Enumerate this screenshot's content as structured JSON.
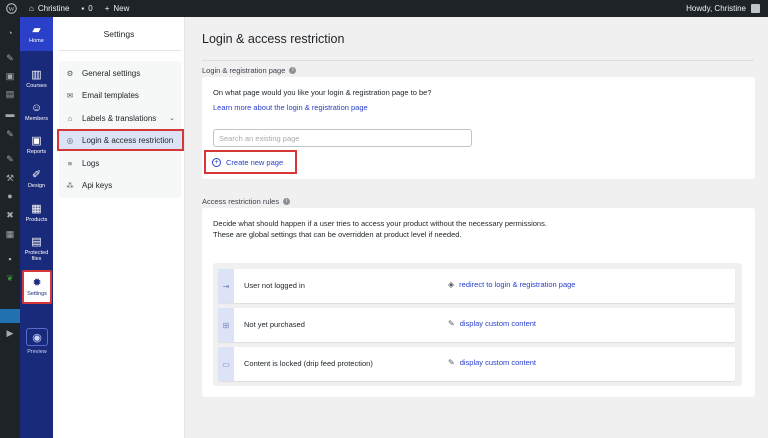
{
  "adminbar": {
    "site_name": "Christine",
    "comments_count": "0",
    "new_label": "New",
    "greeting": "Howdy, Christine"
  },
  "plugin_nav": {
    "home": "Home",
    "courses": "Courses",
    "members": "Members",
    "reports": "Reports",
    "design": "Design",
    "products": "Products",
    "protected_files": "Protected files",
    "settings": "Settings",
    "preview": "Preview"
  },
  "settings_nav": {
    "title": "Settings",
    "items": [
      {
        "label": "General settings",
        "icon": "gear-icon"
      },
      {
        "label": "Email templates",
        "icon": "envelope-icon"
      },
      {
        "label": "Labels & translations",
        "icon": "tag-icon"
      },
      {
        "label": "Login & access restriction",
        "icon": "eye-icon"
      },
      {
        "label": "Logs",
        "icon": "list-icon"
      },
      {
        "label": "Api keys",
        "icon": "api-icon"
      }
    ]
  },
  "main": {
    "title": "Login & access restriction",
    "login_page": {
      "label": "Login & registration page",
      "question": "On what page would you like your login & registration page to be?",
      "learn_more": "Learn more about the login & registration page",
      "search_placeholder": "Search an existing page",
      "create_button": "Create new page"
    },
    "rules": {
      "label": "Access restriction rules",
      "description_line1": "Decide what should happen if a user tries to access your product without the necessary permissions.",
      "description_line2": "These are global settings that can be overridden at product level if needed.",
      "rows": [
        {
          "name": "User not logged in",
          "action": "redirect to login & registration page",
          "action_icon": "redirect-icon",
          "strip_icon": "login-icon"
        },
        {
          "name": "Not yet purchased",
          "action": "display custom content",
          "action_icon": "edit-icon",
          "strip_icon": "cart-icon"
        },
        {
          "name": "Content is locked (drip feed protection)",
          "action": "display custom content",
          "action_icon": "edit-icon",
          "strip_icon": "lock-icon"
        }
      ]
    }
  },
  "colors": {
    "plugin_nav_bg": "#1a2a7a",
    "accent": "#2a40c8",
    "highlight_border": "#d63638"
  }
}
